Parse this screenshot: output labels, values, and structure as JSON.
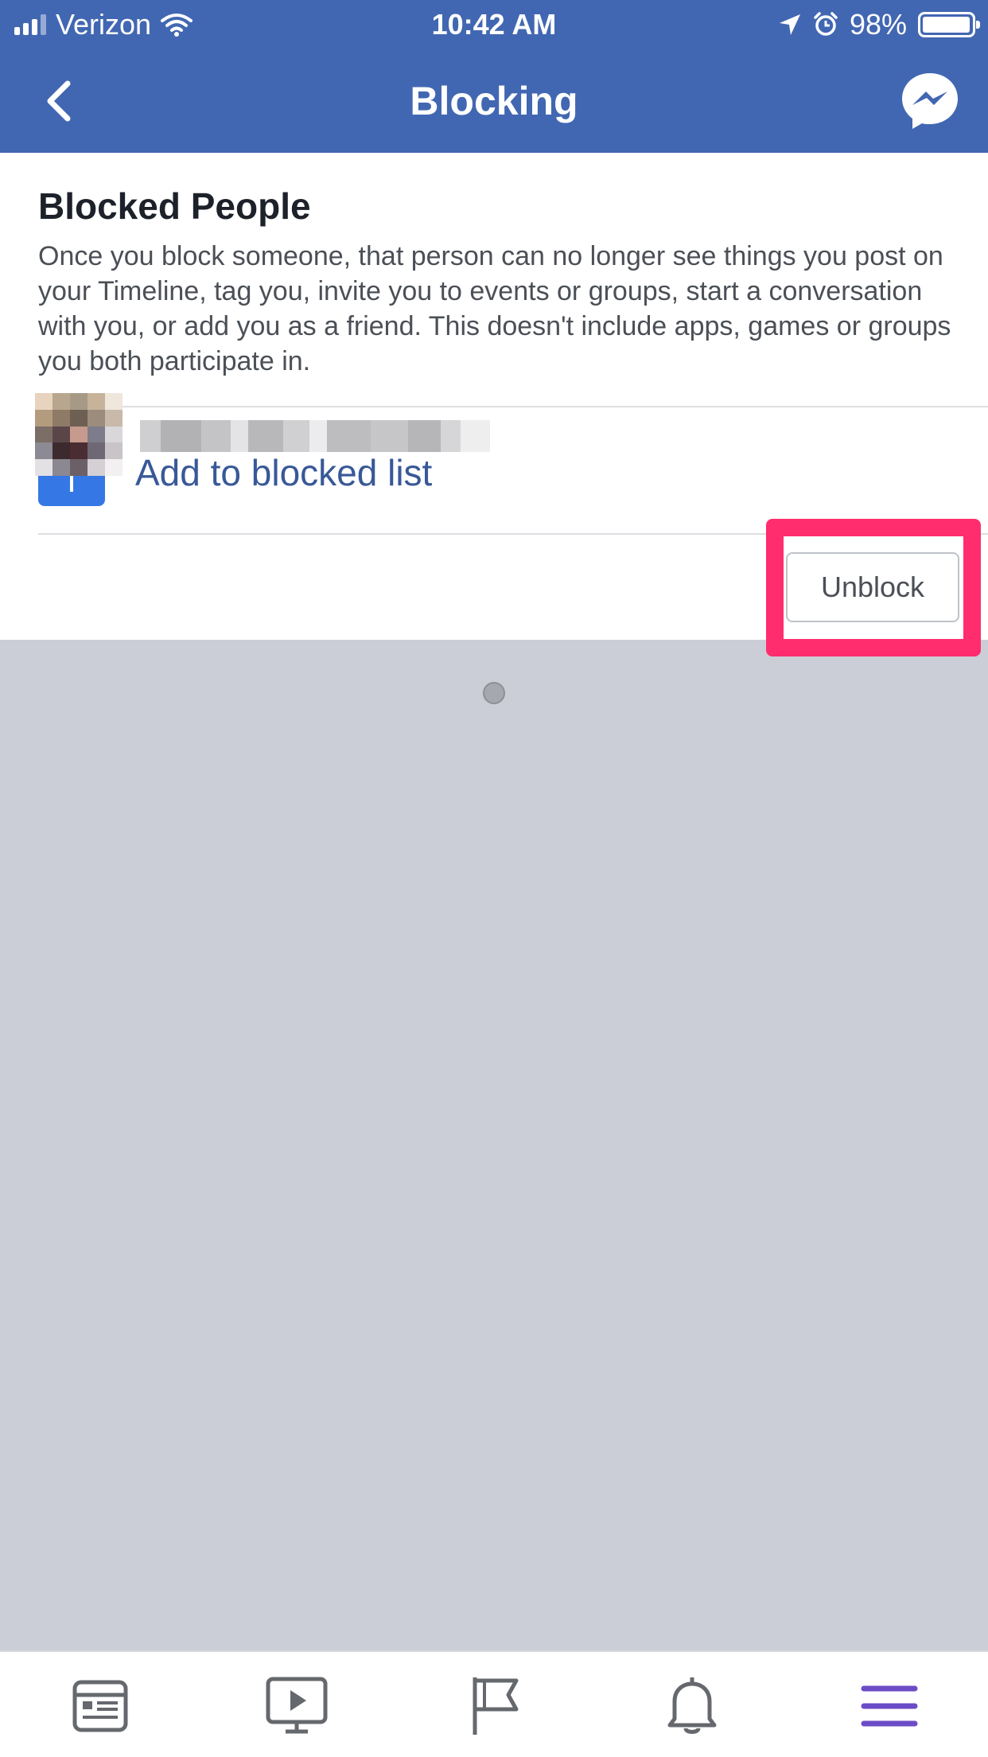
{
  "status_bar": {
    "carrier": "Verizon",
    "time": "10:42 AM",
    "battery": "98%",
    "battery_level": 0.98,
    "icons": [
      "signal-icon",
      "wifi-icon",
      "location-arrow-icon",
      "alarm-icon",
      "battery-icon"
    ]
  },
  "navbar": {
    "title": "Blocking",
    "back_icon": "chevron-left-icon",
    "messenger_icon": "messenger-icon"
  },
  "blocked": {
    "title": "Blocked People",
    "description": "Once you block someone, that person can no longer see things you post on your Timeline, tag you, invite you to events or groups, start a conversation with you, or add you as a friend. This doesn't include apps, games or groups you both participate in.",
    "add_label": "Add to blocked list",
    "people": [
      {
        "name_blurred": true,
        "unblock_label": "Unblock"
      }
    ]
  },
  "tabbar": {
    "tabs": [
      {
        "name": "news-feed-icon",
        "active": false
      },
      {
        "name": "watch-icon",
        "active": false
      },
      {
        "name": "pages-flag-icon",
        "active": false
      },
      {
        "name": "notifications-bell-icon",
        "active": false
      },
      {
        "name": "menu-icon",
        "active": true
      }
    ]
  },
  "colors": {
    "brand": "#4267b2",
    "link": "#385898",
    "add_button": "#3578e5",
    "highlight": "#ff2d6d",
    "active_tab": "#6c4cc6",
    "background": "#cbced7"
  }
}
